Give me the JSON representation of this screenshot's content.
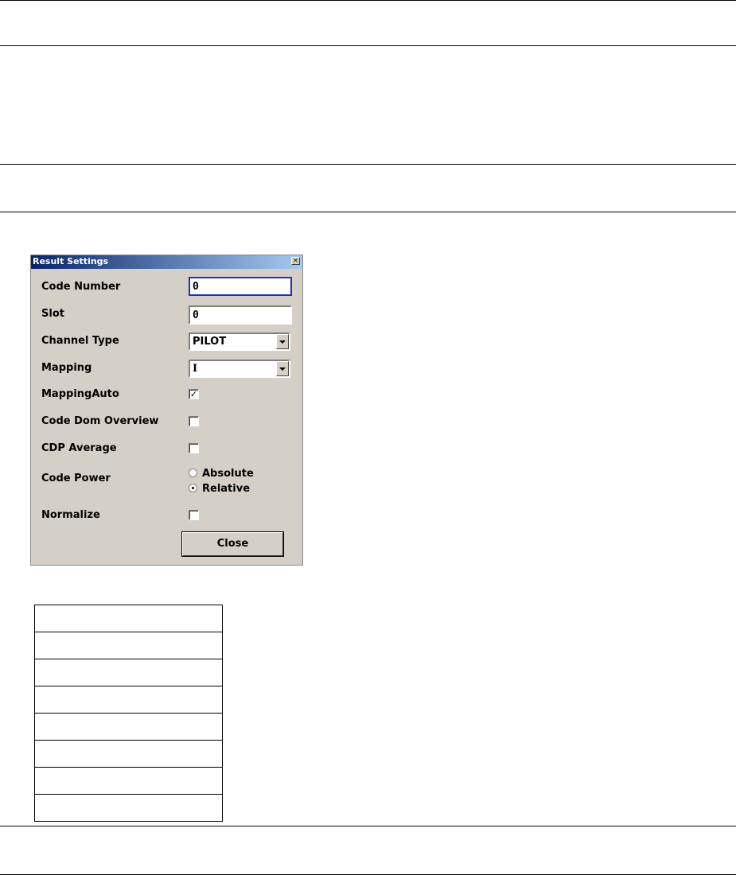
{
  "dialog": {
    "title": "Result Settings",
    "close_glyph": "×",
    "fields": {
      "code_number": {
        "label": "Code Number",
        "value": "0"
      },
      "slot": {
        "label": "Slot",
        "value": "0"
      },
      "channel_type": {
        "label": "Channel Type",
        "value": "PILOT"
      },
      "mapping": {
        "label": "Mapping",
        "value": "I"
      },
      "mapping_auto": {
        "label": "MappingAuto",
        "checked": true,
        "mark": "✓"
      },
      "code_dom_overview": {
        "label": "Code Dom Overview",
        "checked": false
      },
      "cdp_average": {
        "label": "CDP Average",
        "checked": false
      },
      "code_power": {
        "label": "Code Power",
        "options": [
          "Absolute",
          "Relative"
        ],
        "selected": "Relative"
      },
      "normalize": {
        "label": "Normalize",
        "checked": false
      }
    },
    "close_button": "Close"
  },
  "table": {
    "rows": 8
  }
}
